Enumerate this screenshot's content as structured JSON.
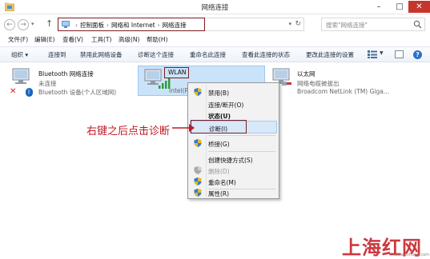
{
  "window": {
    "title": "网络连接"
  },
  "nav": {
    "back_glyph": "←",
    "forward_glyph": "→",
    "up_glyph": "↑",
    "breadcrumbs": [
      "控制面板",
      "网络和 Internet",
      "网络连接"
    ],
    "breadcrumb_separator": "›",
    "search_placeholder": "搜索\"网络连接\""
  },
  "menubar": {
    "items": [
      "文件(F)",
      "编辑(E)",
      "查看(V)",
      "工具(T)",
      "高级(N)",
      "帮助(H)"
    ]
  },
  "commandbar": {
    "items": [
      "组织 ▾",
      "连接到",
      "禁用此网络设备",
      "诊断这个连接",
      "重命名此连接",
      "查看此连接的状态",
      "更改此连接的设置"
    ]
  },
  "adapters": [
    {
      "name": "Bluetooth 网络连接",
      "status": "未连接",
      "device": "Bluetooth 设备(个人区域网)"
    },
    {
      "name": "WLAN",
      "status": "",
      "device": "Intel(R)"
    },
    {
      "name": "以太网",
      "status": "网络电缆被拔出",
      "device": "Broadcom NetLink (TM) Giga..."
    }
  ],
  "context_menu": {
    "items": [
      {
        "label": "禁用(B)",
        "icon": "shield-icon"
      },
      {
        "label": "连接/断开(O)",
        "icon": ""
      },
      {
        "label": "状态(U)",
        "icon": ""
      },
      {
        "label": "诊断(I)",
        "icon": ""
      },
      {
        "label": "桥接(G)",
        "icon": "shield-icon"
      },
      {
        "label": "创建快捷方式(S)",
        "icon": ""
      },
      {
        "label": "删除(D)",
        "icon": "shield-icon"
      },
      {
        "label": "重命名(M)",
        "icon": "shield-icon"
      },
      {
        "label": "属性(R)",
        "icon": "shield-icon"
      }
    ]
  },
  "annotation": {
    "text": "右键之后点击诊断"
  },
  "watermark": {
    "text": "上海红网",
    "small": "www.shhong.com"
  },
  "colors": {
    "accent_red": "#c01922",
    "frame_red": "#7a1c22",
    "selection_blue": "#cbe3f9",
    "close_red": "#c7362d"
  }
}
